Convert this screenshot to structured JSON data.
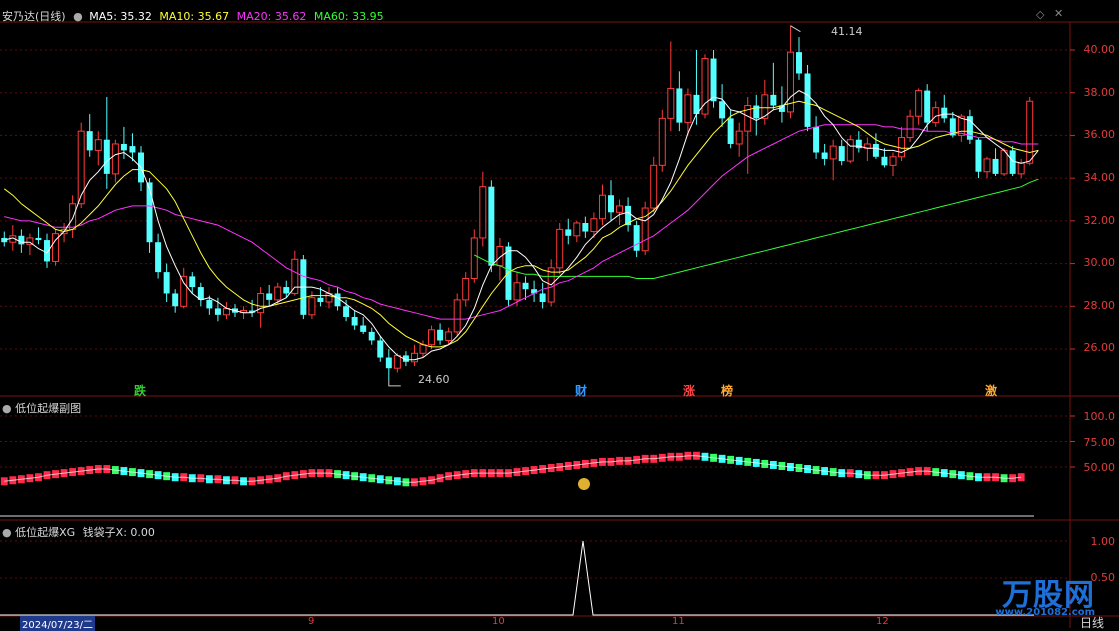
{
  "main": {
    "title": "安乃达(日线)",
    "ma": [
      {
        "label": "MA5: 35.32",
        "color": "#ffffff"
      },
      {
        "label": "MA10: 35.67",
        "color": "#ffff33"
      },
      {
        "label": "MA20: 35.62",
        "color": "#ff33ff"
      },
      {
        "label": "MA60: 33.95",
        "color": "#33ff33"
      }
    ],
    "yaxis": [
      "40.00",
      "38.00",
      "36.00",
      "34.00",
      "32.00",
      "30.00",
      "28.00",
      "26.00"
    ],
    "high_marker": "41.14",
    "low_marker": "24.60",
    "signals": [
      {
        "text": "跌",
        "color": "#33cc33"
      },
      {
        "text": "财",
        "color": "#3399ff"
      },
      {
        "text": "涨",
        "color": "#ff4444"
      },
      {
        "text": "榜",
        "color": "#ffaa33"
      },
      {
        "text": "激",
        "color": "#ffaa33"
      }
    ]
  },
  "sub1": {
    "title": "低位起爆副图",
    "yaxis": [
      "100.0",
      "75.00",
      "50.00"
    ]
  },
  "sub2": {
    "title": "低位起爆XG",
    "value_label": "钱袋子X: 0.00",
    "yaxis": [
      "1.00",
      "0.50"
    ]
  },
  "timeline": {
    "date": "2024/07/23/二",
    "months": [
      "9",
      "10",
      "11",
      "12"
    ]
  },
  "period_button": "日线",
  "watermark": {
    "name": "万股网",
    "url": "www.201082.com"
  },
  "chart_data": {
    "type": "candlestick",
    "ylim": [
      24,
      41
    ],
    "ohlc": [
      [
        31.2,
        31.5,
        30.8,
        31.0
      ],
      [
        31.0,
        31.8,
        30.6,
        31.3
      ],
      [
        31.3,
        31.6,
        30.5,
        30.9
      ],
      [
        30.9,
        31.4,
        30.4,
        31.2
      ],
      [
        31.2,
        31.7,
        30.9,
        31.1
      ],
      [
        31.1,
        31.4,
        29.8,
        30.1
      ],
      [
        30.1,
        31.6,
        29.9,
        31.4
      ],
      [
        31.4,
        31.9,
        31.0,
        31.6
      ],
      [
        31.6,
        33.2,
        31.2,
        32.8
      ],
      [
        32.8,
        36.6,
        32.6,
        36.2
      ],
      [
        36.2,
        37.0,
        35.0,
        35.3
      ],
      [
        35.3,
        36.2,
        34.6,
        35.8
      ],
      [
        35.8,
        37.8,
        33.5,
        34.2
      ],
      [
        34.2,
        35.8,
        33.8,
        35.6
      ],
      [
        35.6,
        36.4,
        34.9,
        35.3
      ],
      [
        35.5,
        36.1,
        34.8,
        35.2
      ],
      [
        35.2,
        35.5,
        33.4,
        33.8
      ],
      [
        33.8,
        34.0,
        30.5,
        31.0
      ],
      [
        31.0,
        31.4,
        29.3,
        29.6
      ],
      [
        29.6,
        30.0,
        28.2,
        28.6
      ],
      [
        28.6,
        28.8,
        27.7,
        28.0
      ],
      [
        28.0,
        29.8,
        27.9,
        29.4
      ],
      [
        29.4,
        29.6,
        28.6,
        28.9
      ],
      [
        28.9,
        29.1,
        28.0,
        28.3
      ],
      [
        28.3,
        28.5,
        27.6,
        27.9
      ],
      [
        27.9,
        28.4,
        27.3,
        27.6
      ],
      [
        27.6,
        28.2,
        27.4,
        27.9
      ],
      [
        27.9,
        28.1,
        27.5,
        27.7
      ],
      [
        27.7,
        28.0,
        27.4,
        27.8
      ],
      [
        27.8,
        28.3,
        27.5,
        27.7
      ],
      [
        27.7,
        28.9,
        27.0,
        28.6
      ],
      [
        28.6,
        29.0,
        28.0,
        28.3
      ],
      [
        28.3,
        29.1,
        28.1,
        28.9
      ],
      [
        28.9,
        29.2,
        28.4,
        28.6
      ],
      [
        28.6,
        30.6,
        28.5,
        30.2
      ],
      [
        30.2,
        30.4,
        27.4,
        27.6
      ],
      [
        27.6,
        28.7,
        27.4,
        28.4
      ],
      [
        28.4,
        28.9,
        28.0,
        28.2
      ],
      [
        28.2,
        28.9,
        27.9,
        28.6
      ],
      [
        28.6,
        28.9,
        27.8,
        28.0
      ],
      [
        28.0,
        28.3,
        27.3,
        27.5
      ],
      [
        27.5,
        27.8,
        26.9,
        27.1
      ],
      [
        27.1,
        27.5,
        26.7,
        26.8
      ],
      [
        26.8,
        27.0,
        26.2,
        26.4
      ],
      [
        26.4,
        26.6,
        25.4,
        25.6
      ],
      [
        25.6,
        26.0,
        24.6,
        25.1
      ],
      [
        25.1,
        25.8,
        24.9,
        25.7
      ],
      [
        25.7,
        25.9,
        25.2,
        25.4
      ],
      [
        25.4,
        26.2,
        25.2,
        25.8
      ],
      [
        25.8,
        26.4,
        25.6,
        26.2
      ],
      [
        26.2,
        27.1,
        26.0,
        26.9
      ],
      [
        26.9,
        27.2,
        26.2,
        26.4
      ],
      [
        26.4,
        27.0,
        26.2,
        26.8
      ],
      [
        26.8,
        28.6,
        26.6,
        28.3
      ],
      [
        28.3,
        29.6,
        28.0,
        29.3
      ],
      [
        29.3,
        31.6,
        29.1,
        31.2
      ],
      [
        31.2,
        34.3,
        30.8,
        33.6
      ],
      [
        33.6,
        33.9,
        29.6,
        29.9
      ],
      [
        29.9,
        31.2,
        29.2,
        30.8
      ],
      [
        30.8,
        31.0,
        28.0,
        28.3
      ],
      [
        28.3,
        29.6,
        28.0,
        29.1
      ],
      [
        29.1,
        29.4,
        28.3,
        28.8
      ],
      [
        28.8,
        29.2,
        28.2,
        28.6
      ],
      [
        28.6,
        29.1,
        27.9,
        28.2
      ],
      [
        28.2,
        30.2,
        28.0,
        29.8
      ],
      [
        29.8,
        31.9,
        29.5,
        31.6
      ],
      [
        31.6,
        32.1,
        30.9,
        31.3
      ],
      [
        31.3,
        32.0,
        31.0,
        31.9
      ],
      [
        31.9,
        32.2,
        31.2,
        31.5
      ],
      [
        31.5,
        32.4,
        31.2,
        32.1
      ],
      [
        32.1,
        33.7,
        31.8,
        33.2
      ],
      [
        33.2,
        33.9,
        32.0,
        32.4
      ],
      [
        32.4,
        33.0,
        31.8,
        32.7
      ],
      [
        32.7,
        33.1,
        31.5,
        31.8
      ],
      [
        31.8,
        32.0,
        30.3,
        30.6
      ],
      [
        30.6,
        32.9,
        30.4,
        32.6
      ],
      [
        32.6,
        35.0,
        32.4,
        34.6
      ],
      [
        34.6,
        37.2,
        34.3,
        36.8
      ],
      [
        36.8,
        40.4,
        36.2,
        38.2
      ],
      [
        38.2,
        39.0,
        36.2,
        36.6
      ],
      [
        36.6,
        38.2,
        36.0,
        37.9
      ],
      [
        37.9,
        40.0,
        36.5,
        37.0
      ],
      [
        37.0,
        39.8,
        36.8,
        39.6
      ],
      [
        39.6,
        40.0,
        37.3,
        37.6
      ],
      [
        37.6,
        38.4,
        36.4,
        36.8
      ],
      [
        36.8,
        37.2,
        35.4,
        35.6
      ],
      [
        35.6,
        36.6,
        35.0,
        36.2
      ],
      [
        36.2,
        37.8,
        34.2,
        37.4
      ],
      [
        37.4,
        37.9,
        36.0,
        36.8
      ],
      [
        36.8,
        38.6,
        36.5,
        37.9
      ],
      [
        37.9,
        39.4,
        37.2,
        37.4
      ],
      [
        37.4,
        38.3,
        36.6,
        37.1
      ],
      [
        37.1,
        41.14,
        36.8,
        39.9
      ],
      [
        39.9,
        40.6,
        38.6,
        38.9
      ],
      [
        38.9,
        39.3,
        36.2,
        36.4
      ],
      [
        36.4,
        36.9,
        34.9,
        35.2
      ],
      [
        35.2,
        35.6,
        34.6,
        34.9
      ],
      [
        34.9,
        35.8,
        33.9,
        35.5
      ],
      [
        35.5,
        35.8,
        34.6,
        34.8
      ],
      [
        34.8,
        36.0,
        34.7,
        35.8
      ],
      [
        35.8,
        36.2,
        35.2,
        35.4
      ],
      [
        35.4,
        35.9,
        34.8,
        35.6
      ],
      [
        35.6,
        36.1,
        34.9,
        35.0
      ],
      [
        35.0,
        35.4,
        34.5,
        34.6
      ],
      [
        34.6,
        35.2,
        34.1,
        35.0
      ],
      [
        35.0,
        36.4,
        34.8,
        35.9
      ],
      [
        35.9,
        37.2,
        35.7,
        36.9
      ],
      [
        36.9,
        38.2,
        36.5,
        38.1
      ],
      [
        38.1,
        38.4,
        36.2,
        36.6
      ],
      [
        36.6,
        37.6,
        36.4,
        37.3
      ],
      [
        37.3,
        37.9,
        36.6,
        36.8
      ],
      [
        36.8,
        37.1,
        35.9,
        36.0
      ],
      [
        36.0,
        37.0,
        35.7,
        36.9
      ],
      [
        36.9,
        37.2,
        35.6,
        35.8
      ],
      [
        35.8,
        35.9,
        34.0,
        34.3
      ],
      [
        34.3,
        35.0,
        34.0,
        34.9
      ],
      [
        34.9,
        35.4,
        34.1,
        34.2
      ],
      [
        34.2,
        35.4,
        34.1,
        35.3
      ],
      [
        35.3,
        35.5,
        34.1,
        34.2
      ],
      [
        34.2,
        34.9,
        34.0,
        34.7
      ],
      [
        34.7,
        37.8,
        34.6,
        37.6
      ]
    ],
    "ma5": [
      31.1,
      31.2,
      31.0,
      31.0,
      30.7,
      30.5,
      31.1,
      31.5,
      32.1,
      33.2,
      33.9,
      34.3,
      34.8,
      35.1,
      35.2,
      34.9,
      34.5,
      33.5,
      32.0,
      30.8,
      29.9,
      29.1,
      28.6,
      28.3,
      28.4,
      28.2,
      27.9,
      27.8,
      27.7,
      27.7,
      27.9,
      28.0,
      28.2,
      28.4,
      28.9,
      28.9,
      28.9,
      28.8,
      28.6,
      28.4,
      28.1,
      27.8,
      27.6,
      27.2,
      26.6,
      26.1,
      25.7,
      25.5,
      25.5,
      25.6,
      25.9,
      26.0,
      26.2,
      26.6,
      27.1,
      27.9,
      29.0,
      29.9,
      30.3,
      30.6,
      30.6,
      30.3,
      29.8,
      29.2,
      29.0,
      29.4,
      29.8,
      30.3,
      30.9,
      31.3,
      31.7,
      32.0,
      32.3,
      32.4,
      32.1,
      32.0,
      32.3,
      33.0,
      33.8,
      34.9,
      36.1,
      37.0,
      37.5,
      37.8,
      37.7,
      37.2,
      37.1,
      36.9,
      36.7,
      36.9,
      37.2,
      37.3,
      37.8,
      38.1,
      37.9,
      37.5,
      36.9,
      36.5,
      35.9,
      35.5,
      35.5,
      35.4,
      35.4,
      35.3,
      35.3,
      35.2,
      35.4,
      35.9,
      36.5,
      36.9,
      37.0,
      37.0,
      36.8,
      36.7,
      36.3,
      35.9,
      35.6,
      35.3,
      34.8,
      34.7,
      34.8,
      35.3
    ],
    "ma10": [
      33.5,
      33.2,
      32.8,
      32.5,
      32.2,
      31.9,
      31.6,
      31.5,
      31.6,
      31.9,
      32.3,
      32.7,
      33.2,
      33.7,
      34.1,
      34.4,
      34.4,
      34.3,
      33.9,
      33.5,
      32.9,
      32.1,
      31.3,
      30.5,
      29.8,
      29.3,
      28.9,
      28.6,
      28.3,
      28.1,
      28.0,
      28.0,
      28.1,
      28.2,
      28.3,
      28.4,
      28.5,
      28.5,
      28.5,
      28.4,
      28.4,
      28.3,
      28.1,
      27.9,
      27.6,
      27.2,
      26.9,
      26.6,
      26.4,
      26.2,
      26.1,
      26.1,
      26.2,
      26.4,
      26.8,
      27.4,
      28.0,
      28.6,
      29.1,
      29.6,
      29.8,
      29.9,
      29.9,
      29.7,
      29.6,
      29.6,
      29.7,
      30.0,
      30.3,
      30.7,
      31.2,
      31.4,
      31.7,
      31.9,
      32.1,
      32.2,
      32.5,
      32.9,
      33.4,
      34.0,
      34.6,
      35.1,
      35.6,
      36.1,
      36.5,
      36.9,
      37.1,
      37.2,
      37.3,
      37.3,
      37.3,
      37.4,
      37.5,
      37.6,
      37.5,
      37.4,
      37.2,
      37.0,
      36.8,
      36.6,
      36.4,
      36.1,
      35.8,
      35.6,
      35.5,
      35.4,
      35.4,
      35.5,
      35.7,
      35.9,
      36.0,
      36.1,
      36.2,
      36.2,
      36.1,
      36.0,
      35.8,
      35.6,
      35.4,
      35.3,
      35.2,
      35.3
    ],
    "ma20": [
      32.2,
      32.1,
      32.0,
      32.0,
      31.9,
      31.8,
      31.7,
      31.7,
      31.7,
      31.8,
      32.0,
      32.1,
      32.3,
      32.5,
      32.6,
      32.7,
      32.7,
      32.7,
      32.6,
      32.5,
      32.3,
      32.2,
      32.1,
      32.0,
      31.9,
      31.8,
      31.6,
      31.4,
      31.2,
      31.0,
      30.7,
      30.4,
      30.1,
      29.8,
      29.6,
      29.4,
      29.3,
      29.2,
      29.0,
      28.9,
      28.7,
      28.6,
      28.4,
      28.3,
      28.1,
      28.0,
      27.9,
      27.8,
      27.7,
      27.6,
      27.5,
      27.4,
      27.4,
      27.4,
      27.4,
      27.5,
      27.6,
      27.7,
      27.8,
      28.0,
      28.2,
      28.4,
      28.6,
      28.8,
      28.9,
      29.1,
      29.2,
      29.4,
      29.6,
      29.8,
      30.1,
      30.3,
      30.5,
      30.7,
      30.9,
      31.1,
      31.3,
      31.6,
      31.9,
      32.2,
      32.5,
      32.9,
      33.3,
      33.7,
      34.1,
      34.4,
      34.7,
      35.0,
      35.2,
      35.4,
      35.6,
      35.8,
      36.0,
      36.2,
      36.3,
      36.4,
      36.5,
      36.5,
      36.5,
      36.5,
      36.5,
      36.5,
      36.5,
      36.4,
      36.4,
      36.3,
      36.3,
      36.3,
      36.2,
      36.2,
      36.2,
      36.1,
      36.1,
      36.0,
      35.9,
      35.9,
      35.8,
      35.7,
      35.7,
      35.6,
      35.6,
      35.6
    ],
    "ma60": [
      null,
      null,
      null,
      null,
      null,
      null,
      null,
      null,
      null,
      null,
      null,
      null,
      null,
      null,
      null,
      null,
      null,
      null,
      null,
      null,
      null,
      null,
      null,
      null,
      null,
      null,
      null,
      null,
      null,
      null,
      null,
      null,
      null,
      null,
      null,
      null,
      null,
      null,
      null,
      null,
      null,
      null,
      null,
      null,
      null,
      null,
      null,
      null,
      null,
      null,
      null,
      null,
      null,
      null,
      null,
      30.4,
      30.2,
      30.0,
      29.9,
      29.7,
      29.6,
      29.5,
      29.5,
      29.4,
      29.4,
      29.4,
      29.4,
      29.4,
      29.4,
      29.4,
      29.4,
      29.4,
      29.4,
      29.4,
      29.3,
      29.3,
      29.3,
      29.4,
      29.5,
      29.6,
      29.7,
      29.8,
      29.9,
      30.0,
      30.1,
      30.2,
      30.3,
      30.4,
      30.5,
      30.6,
      30.7,
      30.8,
      30.9,
      31.0,
      31.1,
      31.2,
      31.3,
      31.4,
      31.5,
      31.6,
      31.7,
      31.8,
      31.9,
      32.0,
      32.1,
      32.2,
      32.3,
      32.4,
      32.5,
      32.6,
      32.7,
      32.8,
      32.9,
      33.0,
      33.1,
      33.2,
      33.3,
      33.4,
      33.5,
      33.6,
      33.8,
      33.95
    ],
    "sub1_values": [
      36,
      37,
      38,
      39,
      40,
      42,
      43,
      44,
      45,
      46,
      47,
      48,
      48,
      47,
      46,
      45,
      44,
      43,
      42,
      41,
      40,
      40,
      39,
      39,
      38,
      38,
      37,
      37,
      36,
      36,
      37,
      38,
      39,
      41,
      42,
      43,
      44,
      44,
      44,
      43,
      42,
      41,
      40,
      39,
      38,
      37,
      36,
      35,
      35,
      36,
      37,
      39,
      41,
      42,
      43,
      44,
      44,
      44,
      44,
      44,
      45,
      46,
      47,
      48,
      49,
      50,
      51,
      52,
      53,
      54,
      55,
      55,
      56,
      56,
      57,
      58,
      58,
      59,
      60,
      60,
      61,
      61,
      60,
      59,
      58,
      57,
      56,
      55,
      54,
      53,
      52,
      51,
      50,
      49,
      48,
      47,
      46,
      45,
      44,
      44,
      43,
      42,
      42,
      42,
      43,
      44,
      45,
      46,
      46,
      45,
      44,
      43,
      42,
      41,
      40,
      40,
      40,
      39,
      39,
      40
    ],
    "sub2_spike_index": 62
  }
}
